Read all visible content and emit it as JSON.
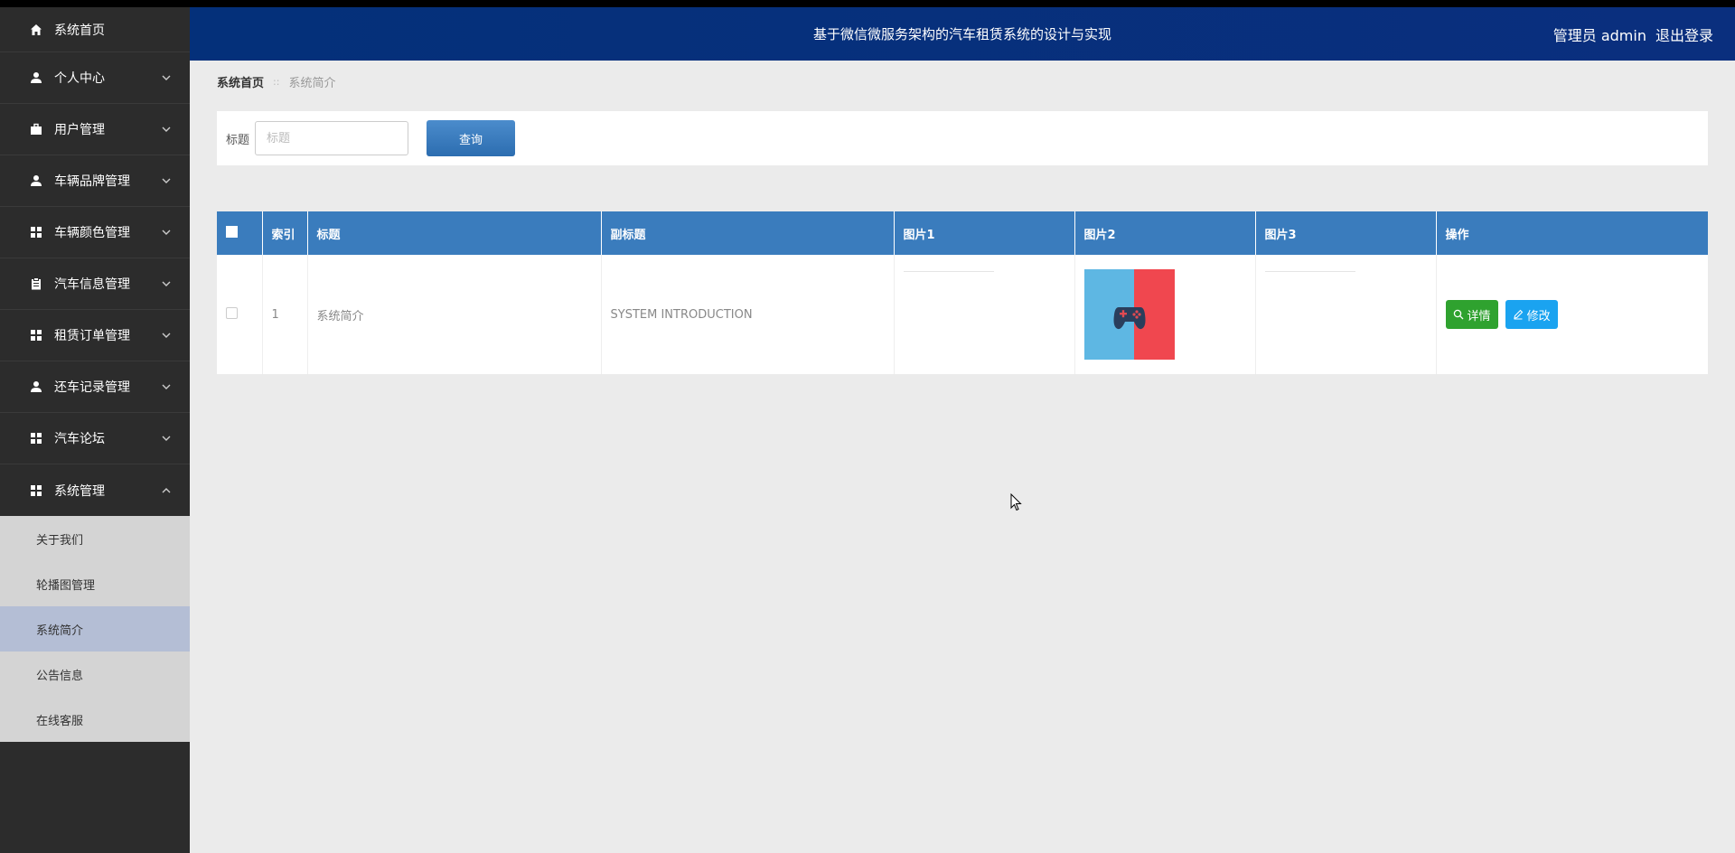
{
  "app": {
    "title": "基于微信微服务架构的汽车租赁系统的设计与实现",
    "user_role": "管理员 admin",
    "logout": "退出登录"
  },
  "sidebar": {
    "items": [
      {
        "label": "系统首页",
        "icon": "home-icon",
        "expandable": false
      },
      {
        "label": "个人中心",
        "icon": "user-icon",
        "expandable": true
      },
      {
        "label": "用户管理",
        "icon": "briefcase-icon",
        "expandable": true
      },
      {
        "label": "车辆品牌管理",
        "icon": "user-icon",
        "expandable": true
      },
      {
        "label": "车辆颜色管理",
        "icon": "grid-icon",
        "expandable": true
      },
      {
        "label": "汽车信息管理",
        "icon": "clipboard-icon",
        "expandable": true
      },
      {
        "label": "租赁订单管理",
        "icon": "grid-icon",
        "expandable": true
      },
      {
        "label": "还车记录管理",
        "icon": "user-icon",
        "expandable": true
      },
      {
        "label": "汽车论坛",
        "icon": "grid-icon",
        "expandable": true
      },
      {
        "label": "系统管理",
        "icon": "grid-icon",
        "expandable": true,
        "expanded": true
      }
    ],
    "submenu": [
      {
        "label": "关于我们"
      },
      {
        "label": "轮播图管理"
      },
      {
        "label": "系统简介",
        "active": true
      },
      {
        "label": "公告信息"
      },
      {
        "label": "在线客服"
      }
    ]
  },
  "breadcrumb": {
    "home": "系统首页",
    "separator": "::",
    "current": "系统简介"
  },
  "search": {
    "label": "标题",
    "placeholder": "标题",
    "value": "",
    "button": "查询"
  },
  "table": {
    "headers": [
      "索引",
      "标题",
      "副标题",
      "图片1",
      "图片2",
      "图片3",
      "操作"
    ],
    "rows": [
      {
        "index": "1",
        "title": "系统简介",
        "subtitle": "SYSTEM INTRODUCTION",
        "img1": "",
        "img2": "gamepad-icon",
        "img3": "",
        "actions": {
          "detail": "详情",
          "edit": "修改"
        }
      }
    ]
  },
  "colors": {
    "header_bg": "#04307a",
    "sidebar_bg": "#2c2c2c",
    "table_head": "#3a7cbd",
    "btn_detail": "#2fa22f",
    "btn_edit": "#1aa3f0"
  }
}
